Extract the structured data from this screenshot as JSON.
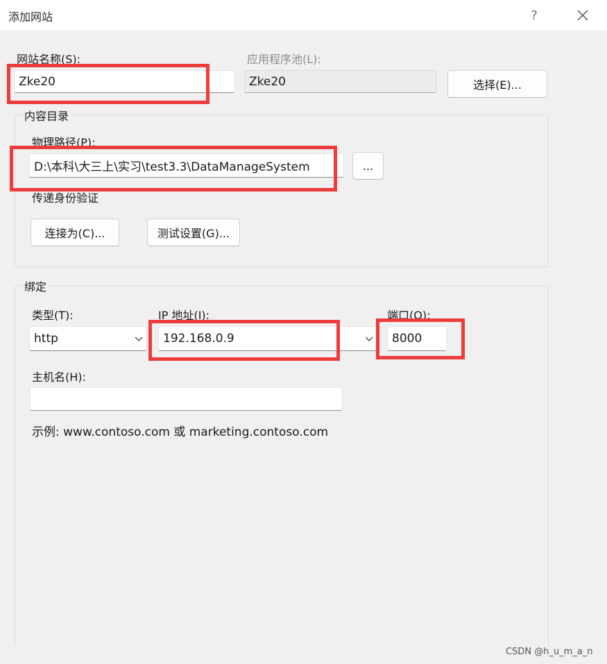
{
  "window": {
    "title": "添加网站",
    "help_glyph": "?"
  },
  "site": {
    "name_label": "网站名称(S):",
    "name_value": "Zke20",
    "apppool_label": "应用程序池(L):",
    "apppool_value": "Zke20",
    "select_button": "选择(E)..."
  },
  "content_dir": {
    "group_title": "内容目录",
    "path_label": "物理路径(P):",
    "path_value": "D:\\本科\\大三上\\实习\\test3.3\\DataManageSystem",
    "browse_button": "...",
    "passthrough_label": "传递身份验证",
    "connect_as_button": "连接为(C)...",
    "test_settings_button": "测试设置(G)..."
  },
  "binding": {
    "group_title": "绑定",
    "type_label": "类型(T):",
    "type_value": "http",
    "ip_label": "IP 地址(I):",
    "ip_value": "192.168.0.9",
    "port_label": "端口(O):",
    "port_value": "8000",
    "hostname_label": "主机名(H):",
    "hostname_value": "",
    "example_text": "示例: www.contoso.com 或 marketing.contoso.com"
  },
  "annotation_color": "#ee3b3b",
  "watermark": "CSDN @h_u_m_a_n"
}
